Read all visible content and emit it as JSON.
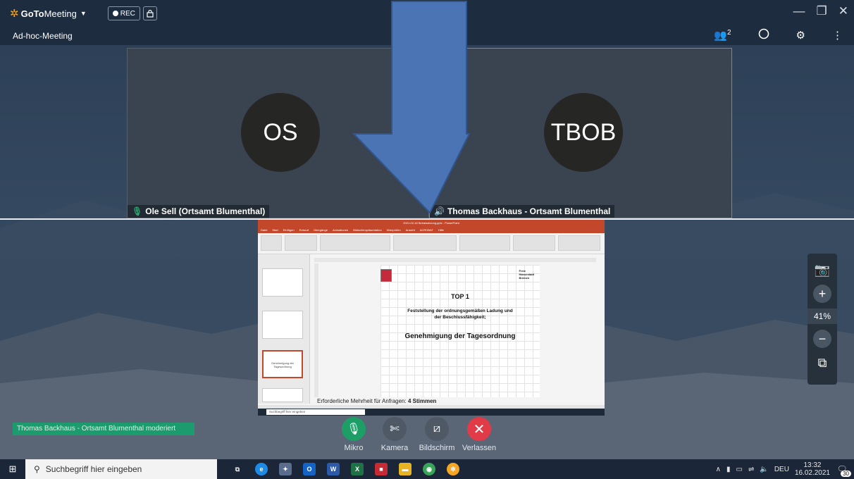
{
  "app": {
    "brand_bold": "GoTo",
    "brand_light": "Meeting",
    "rec_label": "REC"
  },
  "meeting": {
    "title": "Ad-hoc-Meeting",
    "attendee_count": "2"
  },
  "participants": [
    {
      "initials": "OS",
      "name": "Ole Sell (Ortsamt Blumenthal)"
    },
    {
      "initials": "TBOB",
      "name": "Thomas Backhaus - Ortsamt Blumenthal"
    }
  ],
  "share": {
    "app_title": "2021-02-16 Beiratssitzung.pptx - PowerPoint",
    "menu": [
      "Datei",
      "Start",
      "Einfügen",
      "Entwurf",
      "Übergänge",
      "Animationen",
      "Bildschirmpräsentation",
      "Überprüfen",
      "Ansicht",
      "ACROBAT",
      "Hilfe"
    ],
    "thumb_label": "Genehmigung der Tagesordnung",
    "slide_org": [
      "Freie",
      "Hansestadt",
      "Bremen"
    ],
    "slide_top": "TOP 1",
    "slide_sub1": "Feststellung der ordnungsgemäßen Ladung und",
    "slide_sub2": "der Beschlussfähigkeit;",
    "slide_main": "Genehmigung der Tagesordnung",
    "notes_prefix": "Erforderliche Mehrheit für Anfragen: ",
    "notes_bold": "4 Stimmen",
    "search_placeholder": "Suchbegriff hier eingeben"
  },
  "zoom": {
    "value": "41%"
  },
  "moderator_banner": "Thomas Backhaus - Ortsamt Blumenthal moderiert",
  "controls": {
    "mic": "Mikro",
    "camera": "Kamera",
    "screen": "Bildschirm",
    "leave": "Verlassen"
  },
  "colors": {
    "mic": "#1d9e66",
    "neutral": "#4f5966",
    "leave": "#e23b48",
    "banner": "#1c9c6e"
  },
  "taskbar": {
    "search_placeholder": "Suchbegriff hier eingeben",
    "language": "DEU",
    "time": "13:32",
    "date": "16.02.2021",
    "notifications": "30"
  }
}
